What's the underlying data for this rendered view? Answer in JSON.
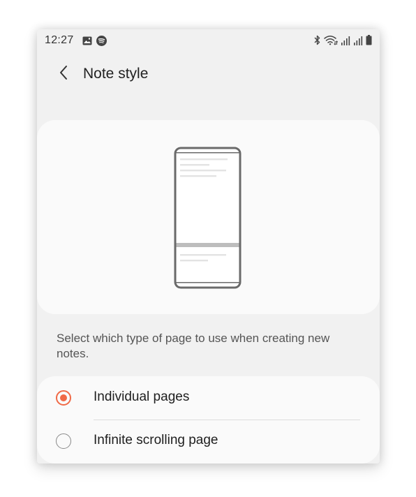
{
  "status_bar": {
    "time": "12:27",
    "left_icons": [
      "image-icon",
      "spotify-icon"
    ],
    "right_icons": [
      "bluetooth-icon",
      "wifi-icon",
      "signal-icon",
      "signal-icon",
      "battery-icon"
    ]
  },
  "header": {
    "title": "Note style"
  },
  "preview": {
    "illustration": "phone-individual-pages-icon"
  },
  "description": "Select which type of page to use when creating new notes.",
  "options": [
    {
      "label": "Individual pages",
      "selected": true
    },
    {
      "label": "Infinite scrolling page",
      "selected": false
    }
  ],
  "colors": {
    "accent": "#f06a47",
    "background": "#f1f1f1",
    "card": "#fafafa"
  }
}
